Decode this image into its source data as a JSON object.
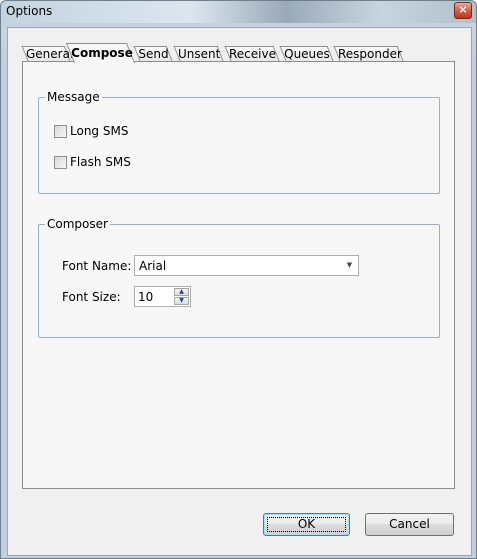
{
  "window": {
    "title": "Options",
    "close_glyph": "×",
    "close_icon": "close-icon"
  },
  "tabs": [
    {
      "label": "General",
      "active": false
    },
    {
      "label": "Compose",
      "active": true
    },
    {
      "label": "Send",
      "active": false
    },
    {
      "label": "Unsent",
      "active": false
    },
    {
      "label": "Receive",
      "active": false
    },
    {
      "label": "Queues",
      "active": false
    },
    {
      "label": "Responder",
      "active": false
    }
  ],
  "message_group": {
    "title": "Message",
    "long_sms": {
      "label": "Long SMS",
      "checked": false
    },
    "flash_sms": {
      "label": "Flash SMS",
      "checked": false
    }
  },
  "composer_group": {
    "title": "Composer",
    "font_name_label": "Font Name:",
    "font_name_value": "Arial",
    "font_size_label": "Font Size:",
    "font_size_value": "10"
  },
  "buttons": {
    "ok": "OK",
    "cancel": "Cancel"
  },
  "colors": {
    "panel_bg": "#f7f7f7",
    "group_border": "#9cb0c2",
    "default_button_border": "#3c7fb1"
  }
}
